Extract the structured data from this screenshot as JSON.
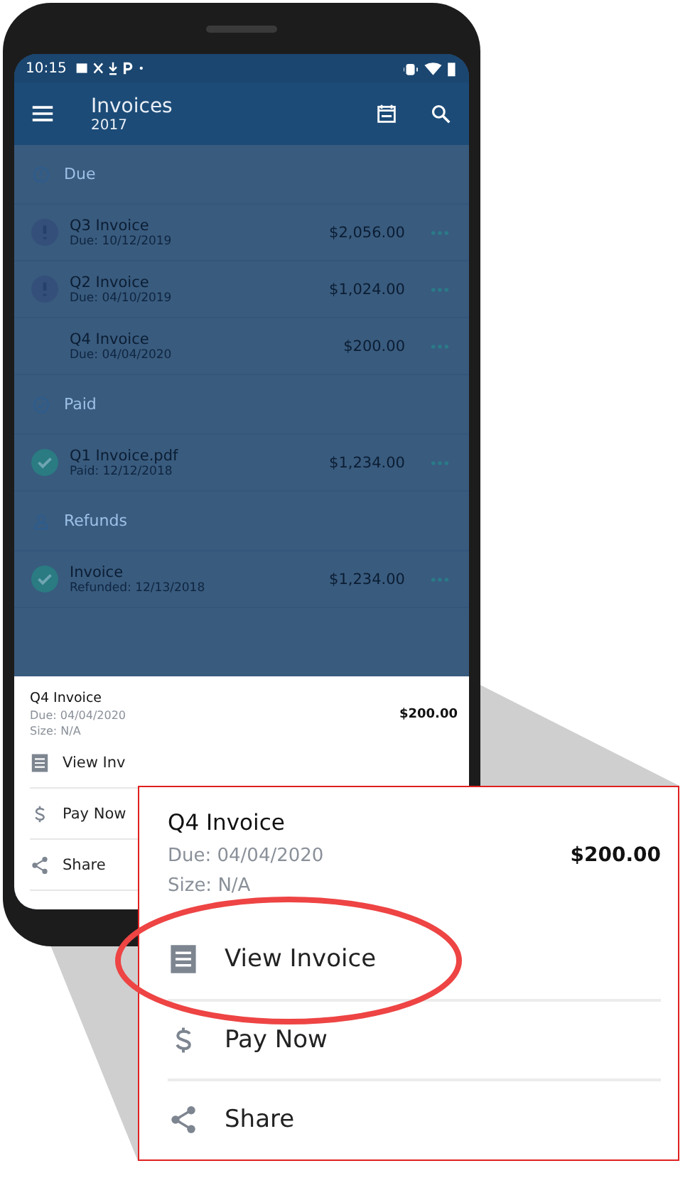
{
  "status_bar": {
    "time": "10:15"
  },
  "app_bar": {
    "title": "Invoices",
    "subtitle": "2017"
  },
  "sections": [
    {
      "label": "Due",
      "kind": "due",
      "items": [
        {
          "title": "Q3 Invoice",
          "subtitle": "Due: 10/12/2019",
          "amount": "$2,056.00",
          "kind": "alert"
        },
        {
          "title": "Q2 Invoice",
          "subtitle": "Due: 04/10/2019",
          "amount": "$1,024.00",
          "kind": "alert"
        },
        {
          "title": "Q4 Invoice",
          "subtitle": "Due: 04/04/2020",
          "amount": "$200.00",
          "kind": "none"
        }
      ]
    },
    {
      "label": "Paid",
      "kind": "paid",
      "items": [
        {
          "title": "Q1 Invoice.pdf",
          "subtitle": "Paid: 12/12/2018",
          "amount": "$1,234.00",
          "kind": "check"
        }
      ]
    },
    {
      "label": "Refunds",
      "kind": "refunds",
      "items": [
        {
          "title": "Invoice",
          "subtitle": "Refunded: 12/13/2018",
          "amount": "$1,234.00",
          "kind": "check"
        }
      ]
    }
  ],
  "bottom_sheet": {
    "title": "Q4 Invoice",
    "due": "Due: 04/04/2020",
    "size": "Size: N/A",
    "amount": "$200.00",
    "actions": [
      {
        "label": "View Inv",
        "kind": "document"
      },
      {
        "label": "Pay Now",
        "kind": "dollar"
      },
      {
        "label": "Share",
        "kind": "share"
      }
    ]
  },
  "callout": {
    "title": "Q4 Invoice",
    "due": "Due: 04/04/2020",
    "size": "Size: N/A",
    "amount": "$200.00",
    "actions": [
      {
        "label": "View Invoice",
        "kind": "document",
        "highlighted": true
      },
      {
        "label": "Pay Now",
        "kind": "dollar",
        "highlighted": false
      },
      {
        "label": "Share",
        "kind": "share",
        "highlighted": false
      }
    ]
  }
}
